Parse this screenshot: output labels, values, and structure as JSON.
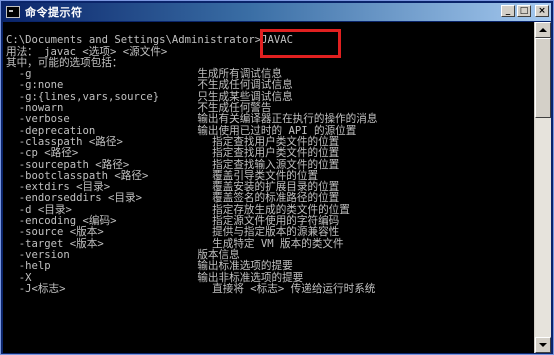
{
  "window": {
    "title": "命令提示符",
    "buttons": {
      "minimize": "_",
      "maximize": "□",
      "close": "×"
    }
  },
  "console": {
    "lines": [
      "",
      "C:\\Documents and Settings\\Administrator>JAVAC",
      "用法： javac <选项> <源文件>",
      "其中，可能的选项包括：",
      "  -g                          生成所有调试信息",
      "  -g:none                     不生成任何调试信息",
      "  -g:{lines,vars,source}      只生成某些调试信息",
      "  -nowarn                     不生成任何警告",
      "  -verbose                    输出有关编译器正在执行的操作的消息",
      "  -deprecation                输出使用已过时的 API 的源位置",
      "  -classpath <路径>              指定查找用户类文件的位置",
      "  -cp <路径>                     指定查找用户类文件的位置",
      "  -sourcepath <路径>             指定查找输入源文件的位置",
      "  -bootclasspath <路径>          覆盖引导类文件的位置",
      "  -extdirs <目录>                覆盖安装的扩展目录的位置",
      "  -endorseddirs <目录>           覆盖签名的标准路径的位置",
      "  -d <目录>                      指定存放生成的类文件的位置",
      "  -encoding <编码>               指定源文件使用的字符编码",
      "  -source <版本>                 提供与指定版本的源兼容性",
      "  -target <版本>                 生成特定 VM 版本的类文件",
      "  -version                    版本信息",
      "  -help                       输出标准选项的提要",
      "  -X                          输出非标准选项的提要",
      "  -J<标志>                       直接将 <标志> 传递给运行时系统"
    ]
  },
  "colors": {
    "console_bg": "#000000",
    "console_text": "#c0c0c0",
    "highlight_border": "#e02020",
    "titlebar_start": "#0a246a",
    "titlebar_end": "#a6caf0"
  },
  "icons": {
    "app": "console-icon",
    "scroll_up": "arrow-up-icon",
    "scroll_down": "arrow-down-icon"
  }
}
